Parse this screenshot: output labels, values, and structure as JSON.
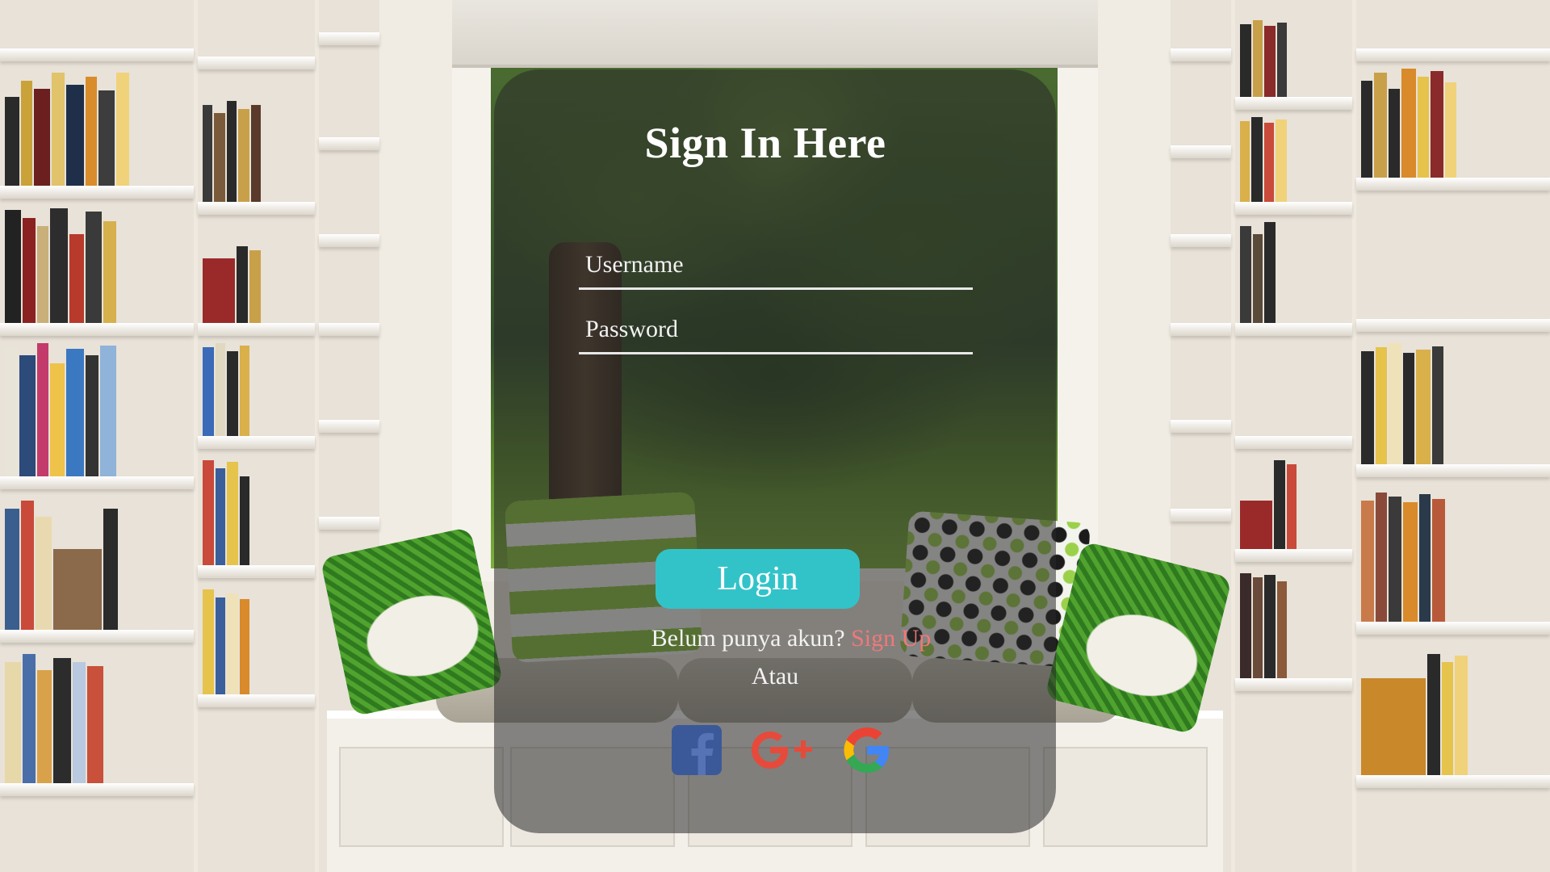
{
  "login": {
    "title": "Sign In Here",
    "username_placeholder": "Username",
    "password_placeholder": "Password",
    "login_label": "Login",
    "no_account_text": "Belum punya akun?",
    "signup_label": "Sign Up",
    "or_text": "Atau"
  },
  "social": {
    "icons": [
      "facebook-icon",
      "google-plus-icon",
      "google-icon"
    ],
    "facebook_color": "#3b5998",
    "google_plus_color": "#e64a3b"
  },
  "colors": {
    "accent": "#32c3c9",
    "signup_link": "#f0787a",
    "panel_overlay": "rgba(40,40,40,0.55)"
  }
}
